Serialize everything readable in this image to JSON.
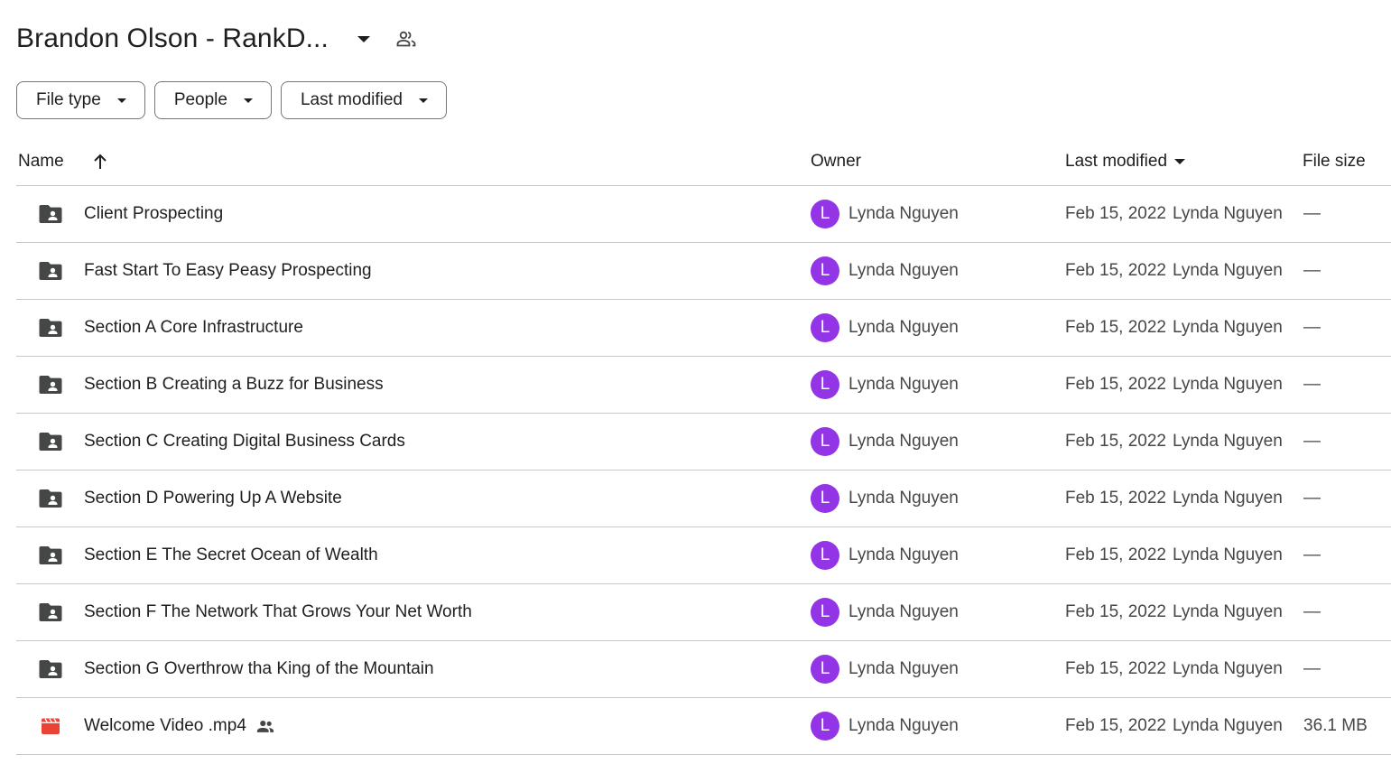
{
  "header": {
    "title": "Brandon Olson - RankD...",
    "shared_icon": "people-icon"
  },
  "filters": [
    {
      "label": "File type"
    },
    {
      "label": "People"
    },
    {
      "label": "Last modified"
    }
  ],
  "columns": {
    "name": "Name",
    "owner": "Owner",
    "last_modified": "Last modified",
    "file_size": "File size"
  },
  "colors": {
    "avatar": "#9334e6",
    "folder_icon": "#444746",
    "video_icon": "#ea4335"
  },
  "rows": [
    {
      "name": "Client Prospecting",
      "icon": "shared-folder-icon",
      "owner_initial": "L",
      "owner": "Lynda Nguyen",
      "modified_date": "Feb 15, 2022",
      "modified_by": "Lynda Nguyen",
      "size": "—"
    },
    {
      "name": "Fast Start To Easy Peasy Prospecting",
      "icon": "shared-folder-icon",
      "owner_initial": "L",
      "owner": "Lynda Nguyen",
      "modified_date": "Feb 15, 2022",
      "modified_by": "Lynda Nguyen",
      "size": "—"
    },
    {
      "name": "Section A Core Infrastructure",
      "icon": "shared-folder-icon",
      "owner_initial": "L",
      "owner": "Lynda Nguyen",
      "modified_date": "Feb 15, 2022",
      "modified_by": "Lynda Nguyen",
      "size": "—"
    },
    {
      "name": "Section B Creating a Buzz for Business",
      "icon": "shared-folder-icon",
      "owner_initial": "L",
      "owner": "Lynda Nguyen",
      "modified_date": "Feb 15, 2022",
      "modified_by": "Lynda Nguyen",
      "size": "—"
    },
    {
      "name": "Section C Creating Digital Business Cards",
      "icon": "shared-folder-icon",
      "owner_initial": "L",
      "owner": "Lynda Nguyen",
      "modified_date": "Feb 15, 2022",
      "modified_by": "Lynda Nguyen",
      "size": "—"
    },
    {
      "name": "Section D Powering Up A Website",
      "icon": "shared-folder-icon",
      "owner_initial": "L",
      "owner": "Lynda Nguyen",
      "modified_date": "Feb 15, 2022",
      "modified_by": "Lynda Nguyen",
      "size": "—"
    },
    {
      "name": "Section E The Secret Ocean of Wealth",
      "icon": "shared-folder-icon",
      "owner_initial": "L",
      "owner": "Lynda Nguyen",
      "modified_date": "Feb 15, 2022",
      "modified_by": "Lynda Nguyen",
      "size": "—"
    },
    {
      "name": "Section F The Network That Grows Your Net Worth",
      "icon": "shared-folder-icon",
      "owner_initial": "L",
      "owner": "Lynda Nguyen",
      "modified_date": "Feb 15, 2022",
      "modified_by": "Lynda Nguyen",
      "size": "—"
    },
    {
      "name": "Section G Overthrow tha King of the Mountain",
      "icon": "shared-folder-icon",
      "owner_initial": "L",
      "owner": "Lynda Nguyen",
      "modified_date": "Feb 15, 2022",
      "modified_by": "Lynda Nguyen",
      "size": "—"
    },
    {
      "name": "Welcome Video .mp4",
      "icon": "video-file-icon",
      "shared": true,
      "owner_initial": "L",
      "owner": "Lynda Nguyen",
      "modified_date": "Feb 15, 2022",
      "modified_by": "Lynda Nguyen",
      "size": "36.1 MB"
    }
  ]
}
